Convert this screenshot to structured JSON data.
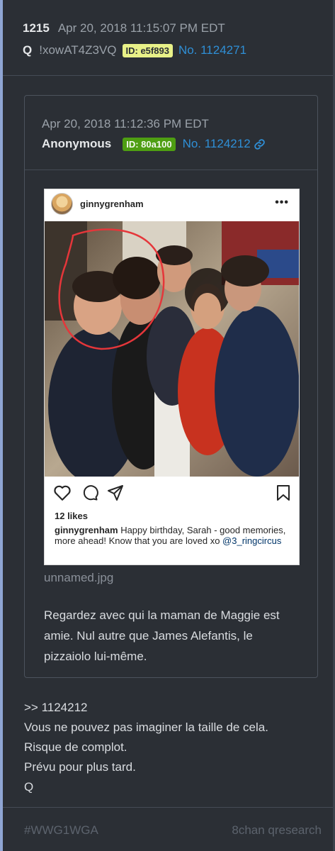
{
  "post": {
    "number": "1215",
    "date": "Apr 20, 2018 11:15:07 PM EDT",
    "author": "Q",
    "tripcode": "!xowAT4Z3VQ",
    "id_badge": "ID: e5f893",
    "post_no": "No. 1124271",
    "body_lines": [
      ">> 1124212",
      "Vous ne pouvez pas imaginer la taille de cela.",
      "Risque de complot.",
      "Prévu pour plus tard.",
      "Q"
    ]
  },
  "quoted": {
    "date": "Apr 20, 2018 11:12:36 PM EDT",
    "author": "Anonymous",
    "id_badge": "ID: 80a100",
    "post_no": "No. 1124212",
    "link_icon": "chain-link-icon",
    "filename": "unnamed.jpg",
    "body_lines": [
      "Regardez avec qui la maman de Maggie est",
      "amie. Nul autre que James Alefantis, le",
      "pizzaiolo lui-même."
    ]
  },
  "instagram": {
    "username": "ginnygrenham",
    "more": "•••",
    "likes": "12 likes",
    "caption_user": "ginnygrenham",
    "caption_text": " Happy birthday, Sarah - good memories, more ahead! Know that you are loved xo ",
    "caption_tag": "@3_ringcircus",
    "icons": [
      "heart-icon",
      "comment-icon",
      "share-icon",
      "bookmark-icon"
    ]
  },
  "footer": {
    "hashtag": "#WWG1WGA",
    "source": "8chan qresearch"
  },
  "colors": {
    "background": "#2b2f35",
    "link": "#2f8fd6",
    "id_yellow": "#e8f188",
    "id_green": "#4e9e12",
    "left_accent": "#8fa5d3"
  }
}
